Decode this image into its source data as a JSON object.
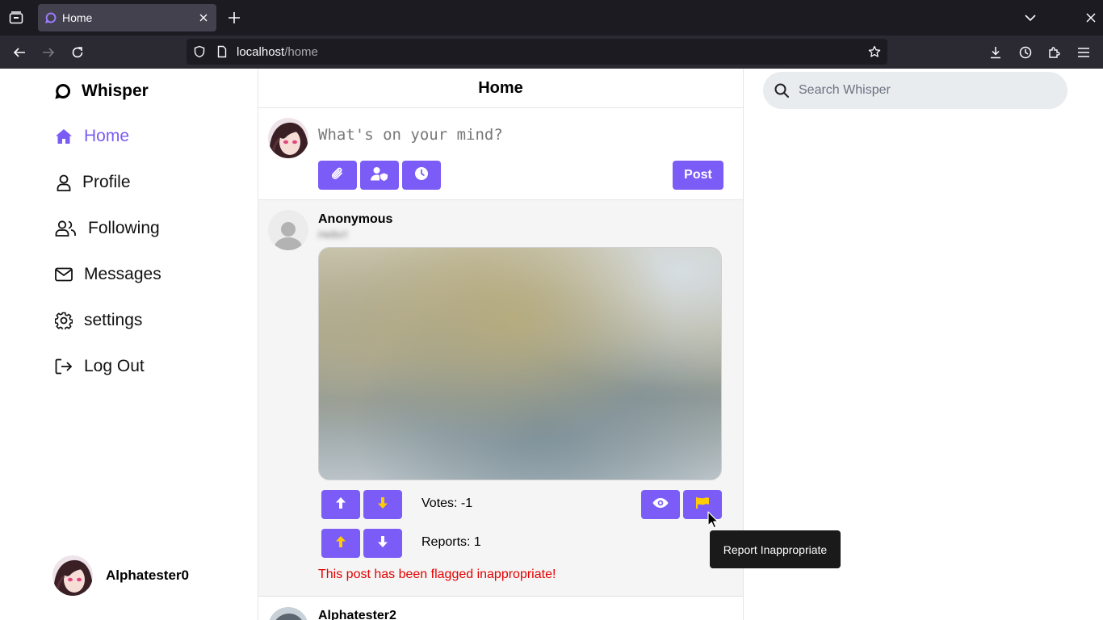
{
  "browser": {
    "tab_title": "Home",
    "url_host": "localhost",
    "url_path": "/home"
  },
  "sidebar": {
    "brand": "Whisper",
    "items": [
      {
        "label": "Home",
        "icon": "home-icon",
        "active": true
      },
      {
        "label": "Profile",
        "icon": "user-icon"
      },
      {
        "label": "Following",
        "icon": "users-icon"
      },
      {
        "label": "Messages",
        "icon": "envelope-icon"
      },
      {
        "label": "settings",
        "icon": "gear-icon"
      },
      {
        "label": "Log Out",
        "icon": "logout-icon"
      }
    ],
    "username": "Alphatester0"
  },
  "main": {
    "title": "Home",
    "composer": {
      "placeholder": "What's on your mind?",
      "post_label": "Post"
    },
    "posts": [
      {
        "author": "Anonymous",
        "votes_label": "Votes: -1",
        "reports_label": "Reports: 1",
        "flag_message": "This post has been flagged inappropriate!"
      },
      {
        "author": "Alphatester2"
      }
    ]
  },
  "search": {
    "placeholder": "Search Whisper"
  },
  "tooltip": "Report Inappropriate",
  "colors": {
    "accent": "#7c5cf6",
    "accent_text": "#7a5cf5",
    "arrow_yellow": "#ffcc00",
    "flag_red": "#e50000"
  }
}
